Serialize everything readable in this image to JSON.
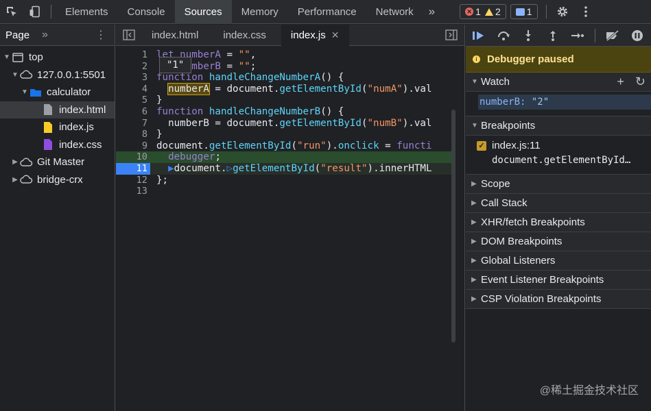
{
  "toolbar": {
    "tabs": [
      "Elements",
      "Console",
      "Sources",
      "Memory",
      "Performance",
      "Network"
    ],
    "active_tab": "Sources",
    "more": "»",
    "error_count": "1",
    "warning_count": "2",
    "message_count": "1"
  },
  "navigator": {
    "title": "Page",
    "more": "»",
    "tree": [
      {
        "label": "top",
        "icon": "frame-icon"
      },
      {
        "label": "127.0.0.1:5501",
        "icon": "cloud-icon"
      },
      {
        "label": "calculator",
        "icon": "folder-icon"
      },
      {
        "label": "index.html",
        "icon": "html-file-icon"
      },
      {
        "label": "index.js",
        "icon": "js-file-icon"
      },
      {
        "label": "index.css",
        "icon": "css-file-icon"
      },
      {
        "label": "Git Master",
        "icon": "cloud-icon"
      },
      {
        "label": "bridge-crx",
        "icon": "cloud-icon"
      }
    ]
  },
  "editor": {
    "tabs": [
      "index.html",
      "index.css",
      "index.js"
    ],
    "active_tab": "index.js",
    "tooltip": "\"1\"",
    "line_numbers": [
      "1",
      "2",
      "3",
      "4",
      "5",
      "6",
      "7",
      "8",
      "9",
      "10",
      "11",
      "12",
      "13"
    ]
  },
  "debugger": {
    "paused_text": "Debugger paused",
    "watch_title": "Watch",
    "watch_key": "numberB:",
    "watch_value": "\"2\"",
    "breakpoints_title": "Breakpoints",
    "breakpoint_location": "index.js:11",
    "breakpoint_code": "document.getElementById…",
    "sections": [
      "Scope",
      "Call Stack",
      "XHR/fetch Breakpoints",
      "DOM Breakpoints",
      "Global Listeners",
      "Event Listener Breakpoints",
      "CSP Violation Breakpoints"
    ]
  },
  "watermark": "@稀土掘金技术社区",
  "colors": {
    "accent": "#8ab4f8",
    "paused_bg": "#4c4410",
    "exec_line": "#3b82f6"
  }
}
